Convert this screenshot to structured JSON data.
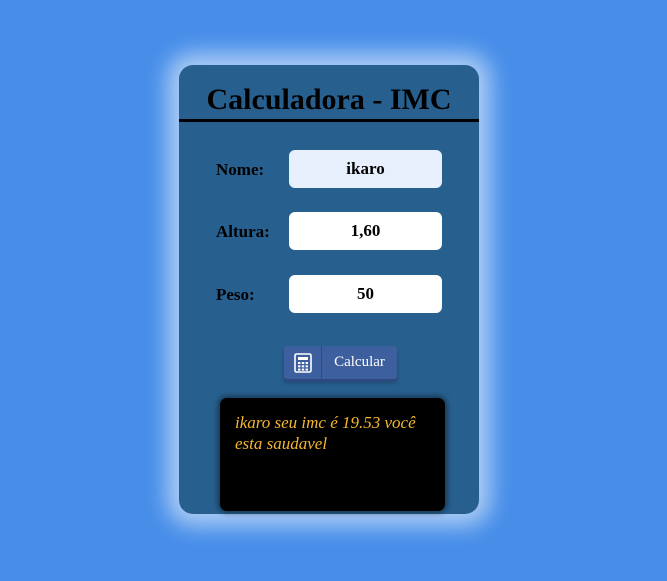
{
  "card": {
    "title": "Calculadora - IMC"
  },
  "form": {
    "nome": {
      "label": "Nome:",
      "value": "ikaro"
    },
    "altura": {
      "label": "Altura:",
      "value": "1,60"
    },
    "peso": {
      "label": "Peso:",
      "value": "50"
    }
  },
  "button": {
    "label": "Calcular",
    "icon": "calculator-icon"
  },
  "result": {
    "text": "ikaro seu imc é 19.53 você esta saudavel"
  },
  "colors": {
    "page_background": "#478ee9",
    "card_background": "#27608f",
    "button_background": "#3e5f9e",
    "result_background": "#000000",
    "result_text": "#f5b731"
  }
}
